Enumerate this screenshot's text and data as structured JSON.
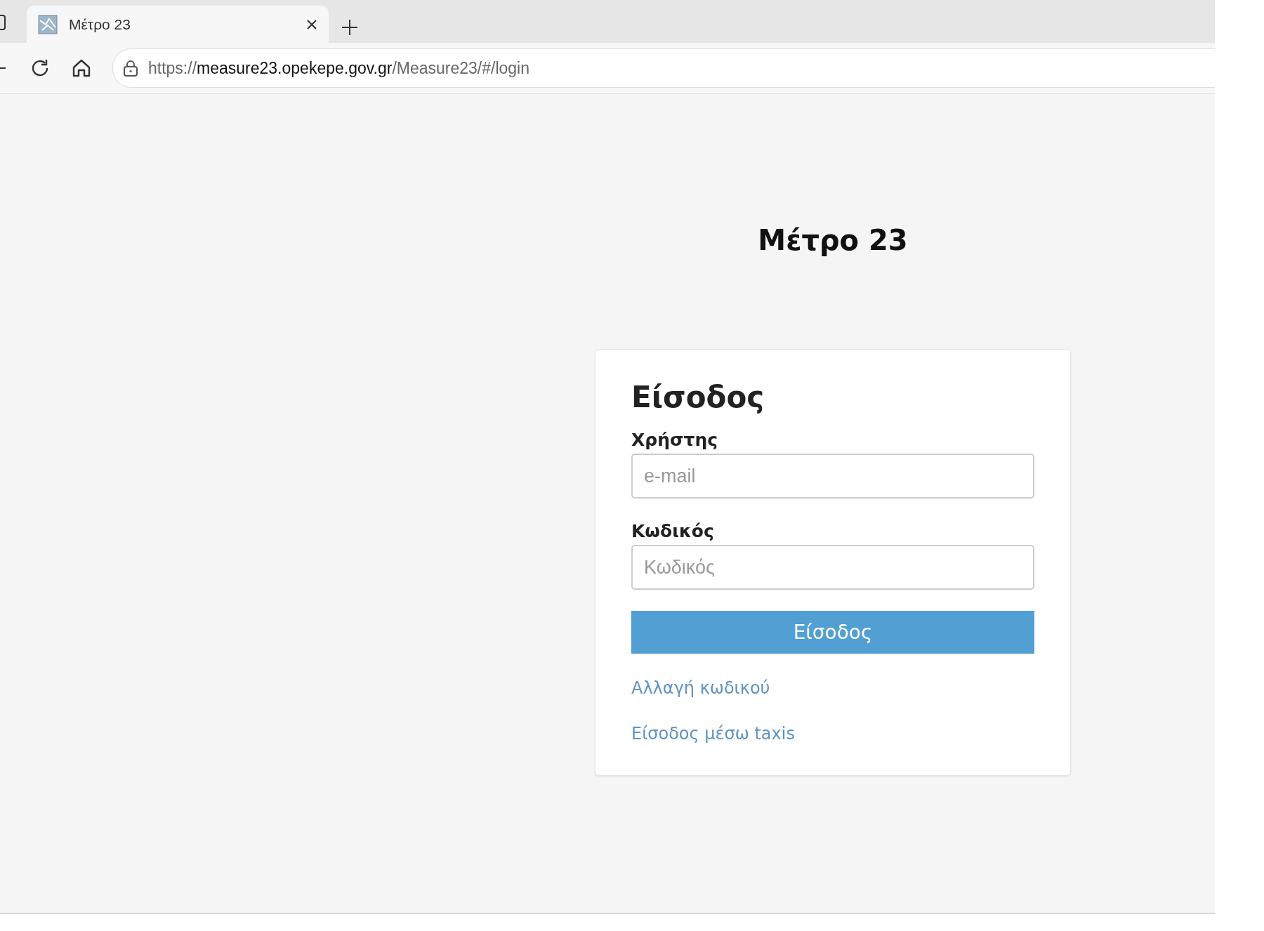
{
  "browser": {
    "tab": {
      "title": "Μέτρο 23",
      "selected": true
    },
    "url": {
      "scheme": "https://",
      "host": "measure23.opekepe.gov.gr",
      "path": "/Measure23/#/login"
    }
  },
  "page": {
    "title": "Μέτρο 23",
    "card": {
      "heading": "Είσοδος",
      "fields": [
        {
          "label": "Χρήστης",
          "placeholder": "e-mail"
        },
        {
          "label": "Κωδικός",
          "placeholder": "Κωδικός"
        }
      ],
      "button": "Είσοδος",
      "links": [
        "Αλλαγή κωδικού",
        "Είσοδος μέσω taxis"
      ]
    }
  }
}
